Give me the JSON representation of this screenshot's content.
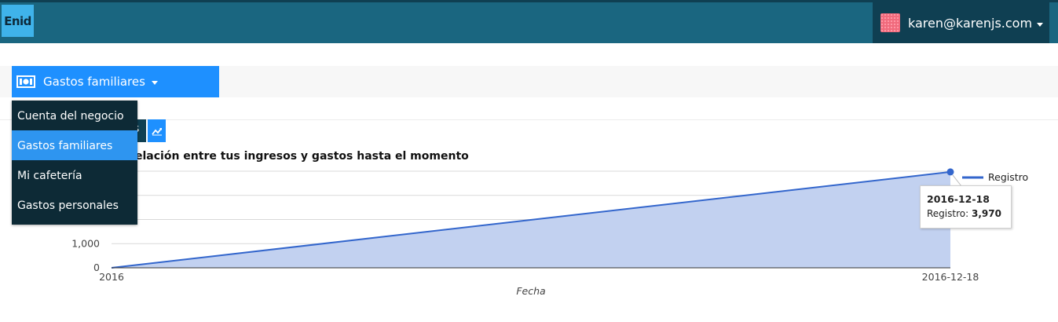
{
  "header": {
    "logo_text": "Enid",
    "user_email": "karen@karenjs.com"
  },
  "account_selector": {
    "selected": "Gastos familiares",
    "options": [
      "Cuenta del negocio",
      "Gastos familiares",
      "Mi cafetería",
      "Gastos personales"
    ]
  },
  "view_toggle": {
    "partial_label": "s"
  },
  "chart_data": {
    "type": "area",
    "subtitle": "elación entre tus ingresos y gastos hasta el momento",
    "xlabel": "Fecha",
    "x_tick_labels": [
      "2016",
      "2016-12-18"
    ],
    "y_tick_labels": [
      "1,000",
      "0"
    ],
    "series": [
      {
        "name": "Registro",
        "x": [
          "2016",
          "2016-12-18"
        ],
        "values": [
          0,
          3970
        ]
      }
    ],
    "ylim": [
      0,
      4000
    ],
    "gridlines": true,
    "legend_position": "right",
    "colors": {
      "line": "#3366cc",
      "fill": "#c2d1f0"
    }
  },
  "tooltip": {
    "date": "2016-12-18",
    "label": "Registro:",
    "value": "3,970"
  }
}
